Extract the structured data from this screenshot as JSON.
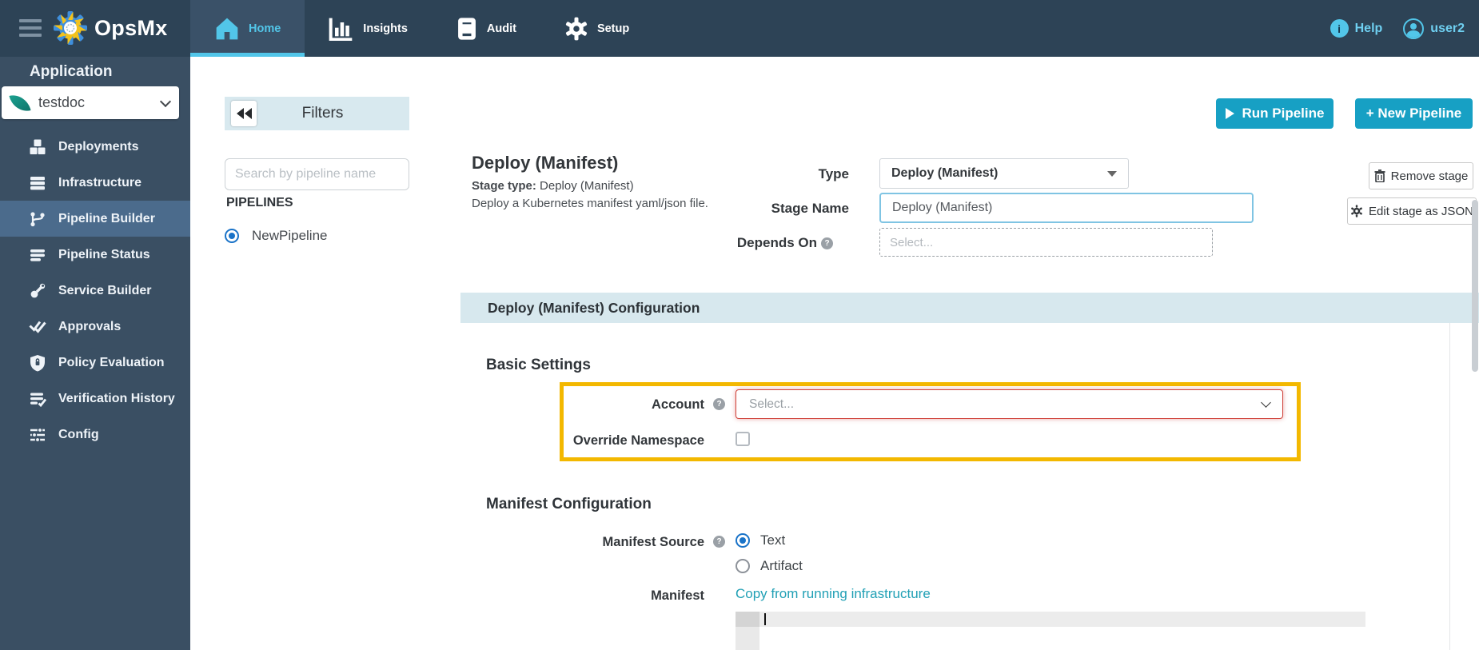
{
  "navbar": {
    "brand": "OpsMx",
    "tabs": [
      {
        "label": "Home",
        "active": true
      },
      {
        "label": "Insights",
        "active": false
      },
      {
        "label": "Audit",
        "active": false
      },
      {
        "label": "Setup",
        "active": false
      }
    ],
    "help_label": "Help",
    "username": "user2"
  },
  "sidebar": {
    "section_label": "Application",
    "app_selector": {
      "value": "testdoc"
    },
    "items": [
      {
        "label": "Deployments"
      },
      {
        "label": "Infrastructure"
      },
      {
        "label": "Pipeline Builder",
        "active": true
      },
      {
        "label": "Pipeline Status"
      },
      {
        "label": "Service Builder"
      },
      {
        "label": "Approvals"
      },
      {
        "label": "Policy Evaluation"
      },
      {
        "label": "Verification History"
      },
      {
        "label": "Config"
      }
    ]
  },
  "filters_panel": {
    "title": "Filters",
    "search_placeholder": "Search by pipeline name",
    "pipelines_heading": "PIPELINES",
    "pipelines": [
      {
        "name": "NewPipeline",
        "selected": true
      }
    ]
  },
  "toolbar": {
    "run_pipeline_label": "Run Pipeline",
    "new_pipeline_label": "+ New Pipeline",
    "remove_stage_label": "Remove stage",
    "edit_json_label": "Edit stage as JSON"
  },
  "stage_header": {
    "title": "Deploy (Manifest)",
    "stage_type_label": "Stage type:",
    "stage_type_value": "Deploy (Manifest)",
    "description": "Deploy a Kubernetes manifest yaml/json file."
  },
  "stage_form": {
    "type_label": "Type",
    "type_value": "Deploy (Manifest)",
    "stage_name_label": "Stage Name",
    "stage_name_value": "Deploy (Manifest)",
    "depends_on_label": "Depends On",
    "depends_on_placeholder": "Select..."
  },
  "config_section": {
    "title": "Deploy (Manifest) Configuration",
    "basic_settings": {
      "heading": "Basic Settings",
      "account_label": "Account",
      "account_placeholder": "Select...",
      "override_namespace_label": "Override Namespace",
      "override_checked": false
    },
    "manifest_configuration": {
      "heading": "Manifest Configuration",
      "manifest_source_label": "Manifest Source",
      "source_options": [
        {
          "label": "Text",
          "selected": true
        },
        {
          "label": "Artifact",
          "selected": false
        }
      ],
      "manifest_label": "Manifest",
      "copy_link": "Copy from running infrastructure",
      "manifest_value": ""
    }
  },
  "colors": {
    "navbar_bg": "#2d4356",
    "sidebar_bg": "#3a4f63",
    "accent_cyan": "#52c6e9",
    "button_teal": "#17a0c4",
    "section_band": "#d7e8ee",
    "highlight_yellow": "#f3b800",
    "error_red": "#cf4139",
    "link_teal": "#21a0b5"
  }
}
